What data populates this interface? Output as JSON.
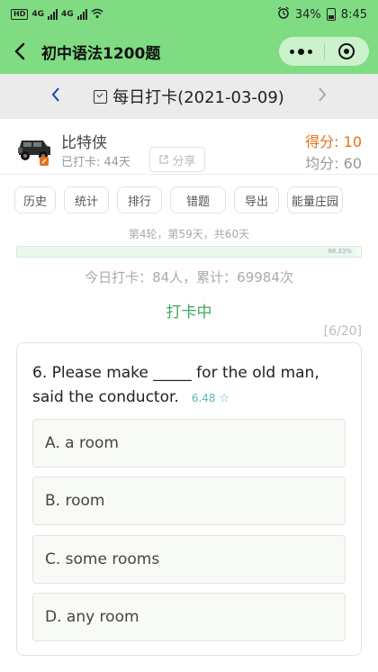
{
  "status_bar": {
    "left_badge_1": "HD",
    "left_badge_2": "4G",
    "left_badge_3": "4G",
    "battery": "34%",
    "time": "8:45"
  },
  "nav": {
    "title": "初中语法1200题"
  },
  "date_bar": {
    "title": "每日打卡(2021-03-09)"
  },
  "user": {
    "name": "比特侠",
    "checked_days": "已打卡: 44天",
    "share_label": "分享",
    "score": "得分: 10",
    "avg_score": "均分: 60"
  },
  "actions": [
    {
      "label": "历史"
    },
    {
      "label": "统计"
    },
    {
      "label": "排行"
    },
    {
      "label": "错题"
    },
    {
      "label": "导出"
    },
    {
      "label": "能量庄园"
    }
  ],
  "progress": {
    "round_info": "第4轮，第59天，共60天",
    "percent_text": "98.33%",
    "fraction": 0.9833
  },
  "today": {
    "stats": "今日打卡：84人，累计：69984次",
    "status": "打卡中",
    "counter": "[6/20]"
  },
  "question": {
    "text": "6. Please make _____ for the old man, said the conductor.",
    "meta": "6.48",
    "options": [
      {
        "label": "A. a room"
      },
      {
        "label": "B. room"
      },
      {
        "label": "C. some rooms"
      },
      {
        "label": "D. any room"
      }
    ]
  },
  "colors": {
    "brand_green": "#7fdc83",
    "score_orange": "#e8701a",
    "status_green": "#3caa5c"
  }
}
